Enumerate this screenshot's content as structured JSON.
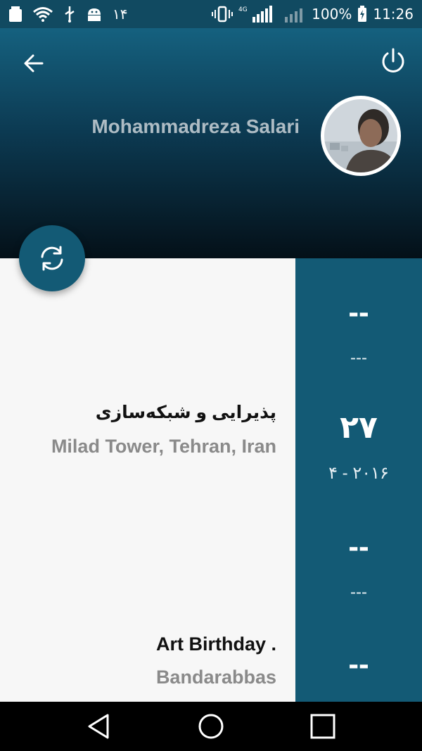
{
  "status_bar": {
    "battery_small": "100",
    "notification_count": "۱۴",
    "net1": "4G",
    "net2": "4G",
    "battery_percent": "100%",
    "time": "11:26"
  },
  "header": {
    "user_name": "Mohammadreza Salari",
    "back_icon": "arrow-left-icon",
    "power_icon": "power-icon"
  },
  "fab": {
    "icon": "refresh-icon"
  },
  "events": [
    {
      "title": "پذیرایی و شبکه‌سازی",
      "location": "Milad Tower, Tehran, Iran"
    },
    {
      "title": "Art Birthday .",
      "location": "Bandarabbas"
    }
  ],
  "dates": [
    {
      "day": "--",
      "month_year": "---"
    },
    {
      "day": "۲۷",
      "month_year": "۴ - ۲۰۱۶"
    },
    {
      "day": "--",
      "month_year": "---"
    },
    {
      "day": "--",
      "month_year": ""
    }
  ],
  "colors": {
    "primary": "#135a75",
    "status_bar": "#114a61",
    "background": "#f7f7f7",
    "nav_bar": "#000000"
  }
}
